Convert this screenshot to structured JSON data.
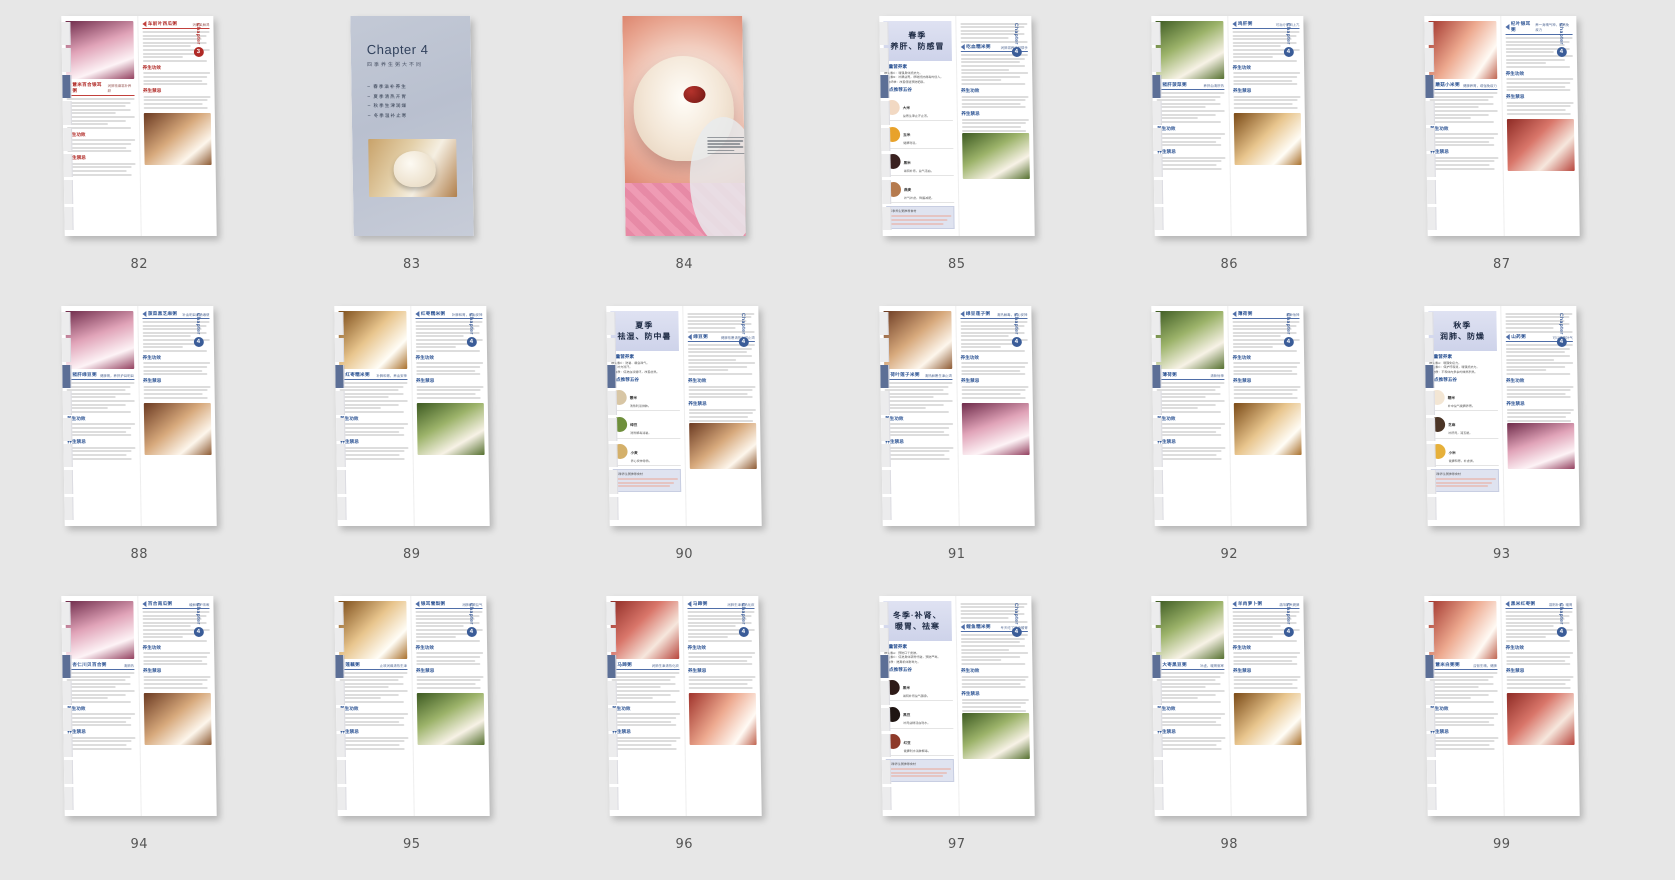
{
  "app": {
    "view_name": "page-thumbnail-grid",
    "background_color": "#e7e7e7",
    "columns": 6,
    "rows": 3
  },
  "pages": [
    {
      "number": "82",
      "type": "spread",
      "chapter_word": "Chapter",
      "chapter_number": "3",
      "chapter_accent": "#b02a26",
      "recipes": [
        {
          "title": "薏米百合银耳粥",
          "subtitle": "润肺祛燥滋补养颜",
          "sections": [
            "养生功效",
            "养生禁忌"
          ]
        },
        {
          "title": "车前叶西瓜粥",
          "subtitle": "消暑又解渴",
          "sections": [
            "养生功效",
            "养生禁忌"
          ]
        }
      ],
      "side_text": "四季养生粥营养搭配"
    },
    {
      "number": "83",
      "type": "chapter-divider",
      "chapter_title": "Chapter 4",
      "chapter_subtitle": "四季养生粥大不同",
      "chapter_items": [
        "春季滋补养生",
        "夏季清热开胃",
        "秋季生津润燥",
        "冬季温补止寒"
      ]
    },
    {
      "number": "84",
      "type": "full-photo",
      "caption_lines": 6,
      "caption_text": "人的健康与自然界的四季息息相关，养生需要顺应一定的准则，春宜生发，夏宜生长之机，秋宜敛藏之机，冬宜温藏之机，四季滋补养生才能健康。"
    },
    {
      "number": "85",
      "type": "season",
      "season_line1": "春季",
      "season_line2": "养肝、防感冒",
      "nutrient_heading": "缺量营养素",
      "nutrients": [
        "维生素C：增强身体抵抗力。",
        "维生素B：补脾益胃，帮助抵抗病毒的侵入。",
        "膳食纤维：改善便秘预防肥胖。"
      ],
      "grain_heading": "重点推荐五谷",
      "grains": [
        {
          "name": "大米",
          "desc": "益胃生津止汗止泻。",
          "color": "#f2d9c3"
        },
        {
          "name": "玉米",
          "desc": "健脾利湿。",
          "color": "#e8a22b"
        },
        {
          "name": "黑米",
          "desc": "滋阴补肾，益气活血。",
          "color": "#3a2120"
        },
        {
          "name": "燕麦",
          "desc": "补气补虚，降脂减肥。",
          "color": "#b57a4e"
        }
      ],
      "table_heading": "四季养生粥推荐食材",
      "recipe_title": "吃血糯米粥",
      "recipe_sub": "润肺滋养的好帮手",
      "sections": [
        "养生功效",
        "养生禁忌"
      ],
      "chapter_word": "Chapter",
      "chapter_number": "4",
      "chapter_accent": "#3a5c98"
    },
    {
      "number": "86",
      "type": "spread",
      "chapter_word": "Chapter",
      "chapter_number": "4",
      "chapter_accent": "#3a5c98",
      "recipes": [
        {
          "title": "猪肝菠菜粥",
          "subtitle": "养肝血清肝热",
          "sections": [
            "养生功效",
            "养生禁忌"
          ]
        },
        {
          "title": "鸡肝粥",
          "subtitle": "可治疗肝阳上亢",
          "sections": [
            "养生功效",
            "养生禁忌"
          ]
        }
      ],
      "side_text": "四季养生粥营养搭配"
    },
    {
      "number": "87",
      "type": "spread",
      "chapter_word": "Chapter",
      "chapter_number": "4",
      "chapter_accent": "#3a5c98",
      "recipes": [
        {
          "title": "蘑菇小米粥",
          "subtitle": "健脾养胃，增强免疫力",
          "sections": [
            "养生功效",
            "养生禁忌"
          ]
        },
        {
          "title": "杞叶银耳粥",
          "subtitle": "养一身精气神，提高免疫力",
          "sections": [
            "养生功效",
            "养生禁忌"
          ]
        }
      ],
      "side_text": "四季养生粥营养搭配"
    },
    {
      "number": "88",
      "type": "spread",
      "chapter_word": "Chapter",
      "chapter_number": "4",
      "chapter_accent": "#3a5c98",
      "recipes": [
        {
          "title": "猪肝绿豆粥",
          "subtitle": "健脾胃，养肝护目明目",
          "sections": [
            "养生功效",
            "养生禁忌"
          ]
        },
        {
          "title": "菠菜黑芝麻粥",
          "subtitle": "补血明目润肠通便",
          "sections": [
            "养生功效",
            "养生禁忌"
          ]
        }
      ],
      "side_text": "四季养生粥营养搭配"
    },
    {
      "number": "89",
      "type": "spread",
      "chapter_word": "Chapter",
      "chapter_number": "4",
      "chapter_accent": "#3a5c98",
      "recipes": [
        {
          "title": "红枣糯米粥",
          "subtitle": "补脾和胃，养血安神",
          "sections": [
            "养生功效",
            "养生禁忌"
          ]
        }
      ],
      "side_text": "四季养生粥营养搭配"
    },
    {
      "number": "90",
      "type": "season",
      "season_line1": "夏季",
      "season_line2": "祛湿、防中暑",
      "nutrient_heading": "缺量营养素",
      "nutrients": [
        "维生素C：防暑、缓急躁气。",
        "钾：补充流汗。",
        "蛋白质：促进血液循环，改善虚热。"
      ],
      "grain_heading": "重点推荐五谷",
      "grains": [
        {
          "name": "薏米",
          "desc": "清热利湿排脓。",
          "color": "#d8c6a5"
        },
        {
          "name": "绿豆",
          "desc": "清热解毒消暑。",
          "color": "#6f8f3c"
        },
        {
          "name": "小麦",
          "desc": "养心安神除热。",
          "color": "#d4b06a"
        }
      ],
      "table_heading": "四季养生粥推荐食材",
      "recipe_title": "绿豆粥",
      "recipe_sub": "健脾祛暑清热利湿止渴",
      "sections": [
        "养生功效",
        "养生禁忌"
      ],
      "chapter_word": "Chapter",
      "chapter_number": "4",
      "chapter_accent": "#3a5c98"
    },
    {
      "number": "91",
      "type": "spread",
      "chapter_word": "Chapter",
      "chapter_number": "4",
      "chapter_accent": "#3a5c98",
      "recipes": [
        {
          "title": "荷叶莲子米粥",
          "subtitle": "清热解暑生津止渴",
          "sections": [
            "养生功效",
            "养生禁忌"
          ]
        },
        {
          "title": "绿豆莲子粥",
          "subtitle": "清热解毒，养心安神",
          "sections": [
            "养生功效",
            "养生禁忌"
          ]
        }
      ],
      "side_text": "四季养生粥营养搭配"
    },
    {
      "number": "92",
      "type": "spread",
      "chapter_word": "Chapter",
      "chapter_number": "4",
      "chapter_accent": "#3a5c98",
      "recipes": [
        {
          "title": "薄荷粥",
          "subtitle": "清新怡神",
          "sections": [
            "养生功效",
            "养生禁忌"
          ]
        }
      ],
      "side_text": "四季养生粥营养搭配"
    },
    {
      "number": "93",
      "type": "season",
      "season_line1": "秋季",
      "season_line2": "润肺、防燥",
      "nutrient_heading": "缺量营养素",
      "nutrients": [
        "维生素A：增强免疫力。",
        "维生素C：保护呼吸道，增强抵抗力。",
        "矿物质：平和体内多余的燥热积热。"
      ],
      "grain_heading": "重点推荐五谷",
      "grains": [
        {
          "name": "糯米",
          "desc": "补中益气健脾养胃。",
          "color": "#f3e6d4"
        },
        {
          "name": "芝麻",
          "desc": "补肝肾，润五脏。",
          "color": "#4b3526"
        },
        {
          "name": "小米",
          "desc": "健脾和胃，补虚损。",
          "color": "#e6b03a"
        }
      ],
      "table_heading": "四季养生粥推荐食材",
      "recipe_title": "山药粥",
      "recipe_sub": "可以健脾补气",
      "sections": [
        "养生功效",
        "养生禁忌"
      ],
      "chapter_word": "Chapter",
      "chapter_number": "4",
      "chapter_accent": "#3a5c98"
    },
    {
      "number": "94",
      "type": "spread",
      "chapter_word": "Chapter",
      "chapter_number": "4",
      "chapter_accent": "#3a5c98",
      "recipes": [
        {
          "title": "杏仁川贝百合粥",
          "subtitle": "清肺热",
          "sections": [
            "养生功效",
            "养生禁忌"
          ]
        },
        {
          "title": "百合南瓜粥",
          "subtitle": "缓解咽干咳嗽",
          "sections": [
            "养生功效",
            "养生禁忌"
          ]
        }
      ],
      "side_text": "四季养生粥营养搭配"
    },
    {
      "number": "95",
      "type": "spread",
      "chapter_word": "Chapter",
      "chapter_number": "4",
      "chapter_accent": "#3a5c98",
      "recipes": [
        {
          "title": "莲藕粥",
          "subtitle": "止咳润燥清热生津",
          "sections": [
            "养生功效",
            "养生禁忌"
          ]
        },
        {
          "title": "银耳雪梨粥",
          "subtitle": "润肺养颜益气",
          "sections": [
            "养生功效",
            "养生禁忌"
          ]
        }
      ],
      "side_text": "四季养生粥营养搭配"
    },
    {
      "number": "96",
      "type": "spread",
      "chapter_word": "Chapter",
      "chapter_number": "4",
      "chapter_accent": "#3a5c98",
      "recipes": [
        {
          "title": "马蹄粥",
          "subtitle": "润肺生津清热化痰",
          "sections": [
            "养生功效",
            "养生禁忌"
          ]
        }
      ],
      "side_text": "四季养生粥营养搭配"
    },
    {
      "number": "97",
      "type": "season",
      "season_line1": "冬季·补肾、",
      "season_line2": "暖胃、祛寒",
      "nutrient_heading": "缺量营养素",
      "nutrients": [
        "维生素A：预防口干皮肤。",
        "维生素C：促进身体新陈代谢，预防严寒。",
        "蛋白质：提高机体耐寒力。"
      ],
      "grain_heading": "重点推荐五谷",
      "grains": [
        {
          "name": "黑米",
          "desc": "滋阴补肾益气强身。",
          "color": "#2e1b18"
        },
        {
          "name": "黑豆",
          "desc": "补肾益精活血利水。",
          "color": "#1f1512"
        },
        {
          "name": "红豆",
          "desc": "健脾利水消肿解毒。",
          "color": "#8e3a2a"
        }
      ],
      "table_heading": "四季养生粥推荐食材",
      "recipe_title": "鲤鱼糯米粥",
      "recipe_sub": "冬天吃了暖身暖胃",
      "sections": [
        "养生功效",
        "养生禁忌"
      ],
      "chapter_word": "Chapter",
      "chapter_number": "4",
      "chapter_accent": "#3a5c98"
    },
    {
      "number": "98",
      "type": "spread",
      "chapter_word": "Chapter",
      "chapter_number": "4",
      "chapter_accent": "#3a5c98",
      "recipes": [
        {
          "title": "大枣黑豆粥",
          "subtitle": "补虚，暖胃驱寒",
          "sections": [
            "养生功效",
            "养生禁忌"
          ]
        },
        {
          "title": "羊肉萝卜粥",
          "subtitle": "温阳补气健脾",
          "sections": [
            "养生功效",
            "养生禁忌"
          ]
        }
      ],
      "side_text": "四季养生粥营养搭配"
    },
    {
      "number": "99",
      "type": "spread",
      "chapter_word": "Chapter",
      "chapter_number": "4",
      "chapter_accent": "#3a5c98",
      "recipes": [
        {
          "title": "薏米白粥粥",
          "subtitle": "益智生精，健脾",
          "sections": [
            "养生功效",
            "养生禁忌"
          ]
        },
        {
          "title": "黑米红枣粥",
          "subtitle": "滋阴补肾，暖胃",
          "sections": [
            "养生功效",
            "养生禁忌"
          ]
        }
      ],
      "side_text": "四季养生粥营养搭配"
    }
  ]
}
